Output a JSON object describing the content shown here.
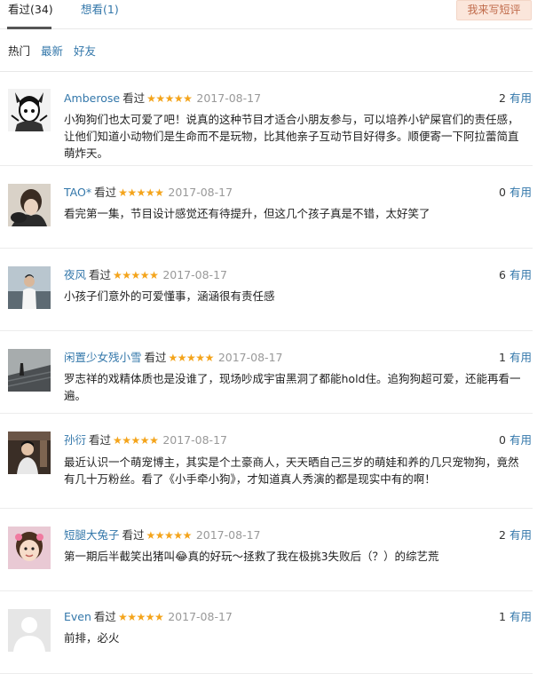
{
  "tabs": {
    "seen_label": "看过(34)",
    "want_label": "想看(1)",
    "write_button": "我来写短评"
  },
  "filters": {
    "hot": "热门",
    "newest": "最新",
    "friends": "好友"
  },
  "colors": {
    "link": "#3377aa",
    "star": "#f4a41b",
    "button_bg": "#fbe6db",
    "button_text": "#c06a4a"
  },
  "comments": [
    {
      "user": "Amberose",
      "action": "看过",
      "stars": "★★★★★",
      "rating": 5,
      "date": "2017-08-17",
      "votes_count": "2",
      "votes_label": "有用",
      "text": "小狗狗们也太可爱了吧！说真的这种节目才适合小朋友参与，可以培养小铲屎官们的责任感，让他们知道小动物们是生命而不是玩物，比其他亲子互动节目好得多。顺便寄一下阿拉蕾简直萌炸天。"
    },
    {
      "user": "TAO*",
      "action": "看过",
      "stars": "★★★★★",
      "rating": 5,
      "date": "2017-08-17",
      "votes_count": "0",
      "votes_label": "有用",
      "text": "看完第一集，节目设计感觉还有待提升，但这几个孩子真是不错，太好笑了"
    },
    {
      "user": "夜风",
      "action": "看过",
      "stars": "★★★★★",
      "rating": 5,
      "date": "2017-08-17",
      "votes_count": "6",
      "votes_label": "有用",
      "text": "小孩子们意外的可爱懂事，涵涵很有责任感"
    },
    {
      "user": "闲置少女残小雪",
      "action": "看过",
      "stars": "★★★★★",
      "rating": 5,
      "date": "2017-08-17",
      "votes_count": "1",
      "votes_label": "有用",
      "text": "罗志祥的戏精体质也是没谁了，现场吵成宇宙黑洞了都能hold住。追狗狗超可爱，还能再看一遍。"
    },
    {
      "user": "孙衍",
      "action": "看过",
      "stars": "★★★★★",
      "rating": 5,
      "date": "2017-08-17",
      "votes_count": "0",
      "votes_label": "有用",
      "text": "最近认识一个萌宠博主，其实是个土豪商人，天天晒自己三岁的萌娃和养的几只宠物狗，竟然有几十万粉丝。看了《小手牵小狗》，才知道真人秀演的都是现实中有的啊！"
    },
    {
      "user": "短腿大兔子",
      "action": "看过",
      "stars": "★★★★★",
      "rating": 5,
      "date": "2017-08-17",
      "votes_count": "2",
      "votes_label": "有用",
      "text": "第一期后半截笑出猪叫😂真的好玩～拯救了我在极挑3失败后（？）的综艺荒"
    },
    {
      "user": "Even",
      "action": "看过",
      "stars": "★★★★★",
      "rating": 5,
      "date": "2017-08-17",
      "votes_count": "1",
      "votes_label": "有用",
      "text": "前排，必火"
    }
  ]
}
